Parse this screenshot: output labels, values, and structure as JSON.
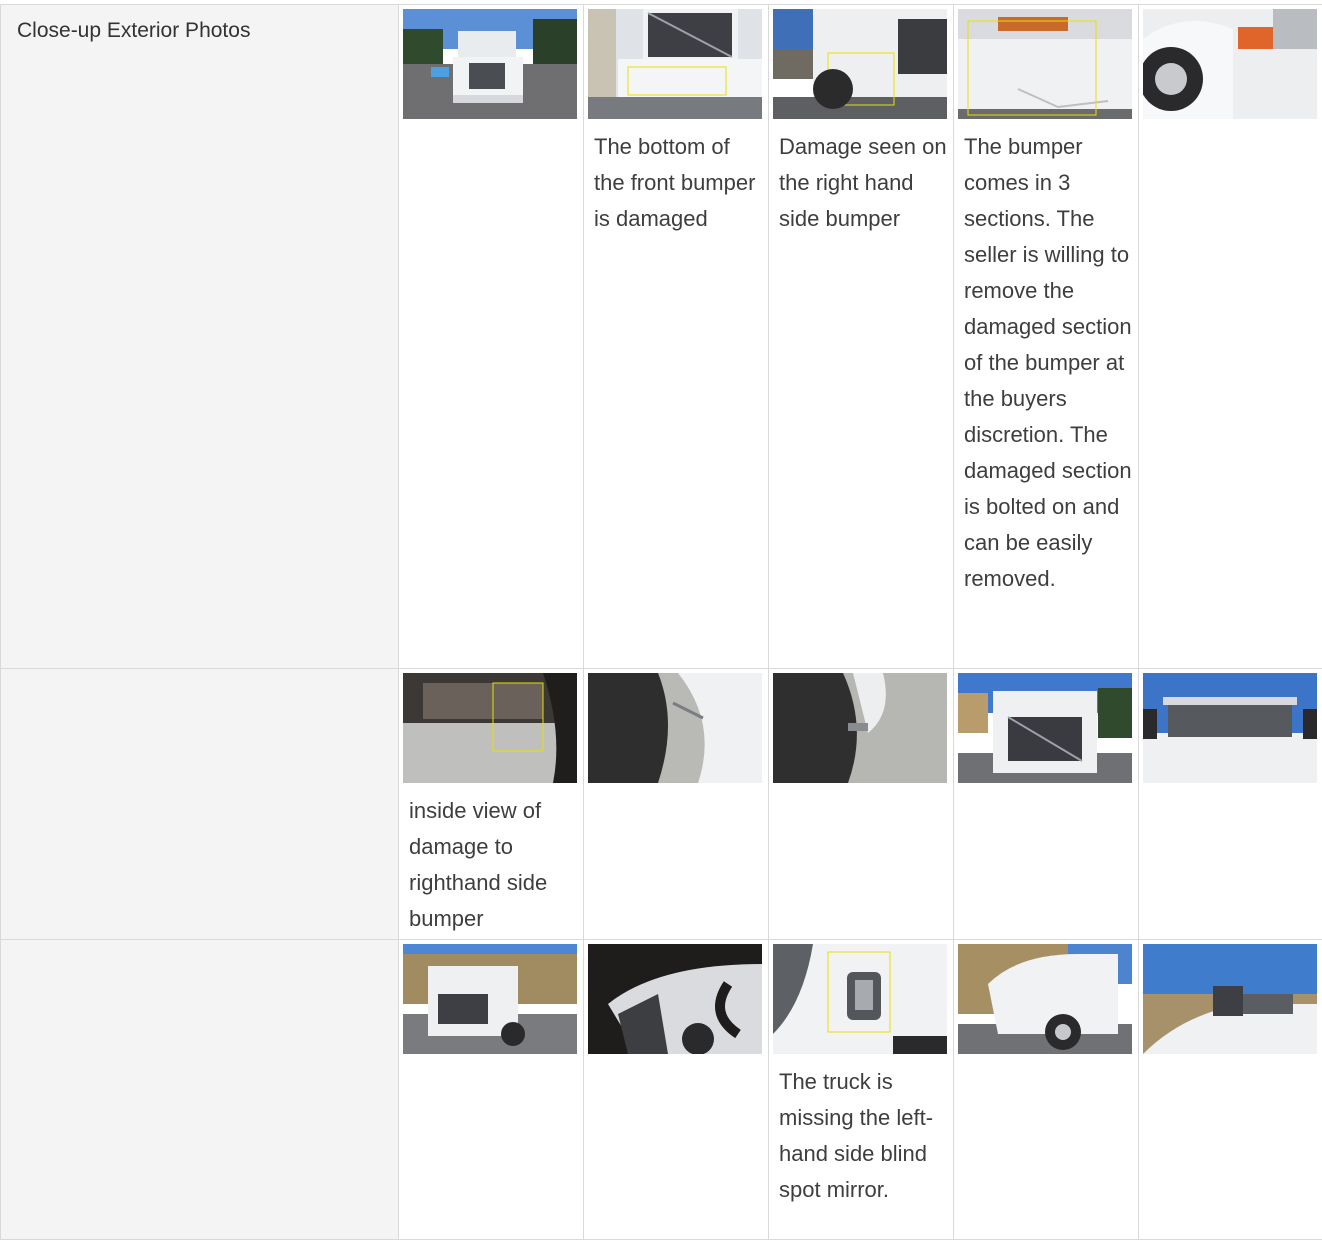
{
  "section": {
    "label": "Close-up Exterior Photos"
  },
  "rows": [
    {
      "photos": [
        {
          "name": "truck-front-parked-photo",
          "caption": ""
        },
        {
          "name": "front-grille-bumper-closeup-photo",
          "caption": "The bottom of the front bumper is damaged"
        },
        {
          "name": "right-bumper-damage-photo",
          "caption": "Damage seen on the right hand side bumper"
        },
        {
          "name": "bumper-section-damage-photo",
          "caption": "The bumper comes in 3 sections. The seller is willing to remove the damaged section of the bumper at the buyers discretion. The damaged section is bolted on and can be easily removed."
        },
        {
          "name": "front-wheel-headlight-photo",
          "caption": ""
        }
      ]
    },
    {
      "photos": [
        {
          "name": "inside-bumper-damage-photo",
          "caption": "inside view of damage to righthand side bumper"
        },
        {
          "name": "wheel-fender-closeup-photo",
          "caption": ""
        },
        {
          "name": "tire-fender-closeup-photo",
          "caption": ""
        },
        {
          "name": "truck-front-grille-photo",
          "caption": ""
        },
        {
          "name": "windshield-cab-photo",
          "caption": ""
        }
      ]
    },
    {
      "photos": [
        {
          "name": "truck-front-three-quarter-photo",
          "caption": ""
        },
        {
          "name": "hood-side-dark-photo",
          "caption": ""
        },
        {
          "name": "missing-mirror-mount-photo",
          "caption": "The truck is missing the left-hand side blind spot mirror."
        },
        {
          "name": "truck-side-profile-photo",
          "caption": ""
        },
        {
          "name": "cab-side-mirror-photo",
          "caption": ""
        }
      ]
    }
  ],
  "colors": {
    "heading_blue": "#1b8fe0",
    "label_bg": "#f4f4f4",
    "border": "#d9d9d9",
    "highlight_box": "#e8e000"
  }
}
